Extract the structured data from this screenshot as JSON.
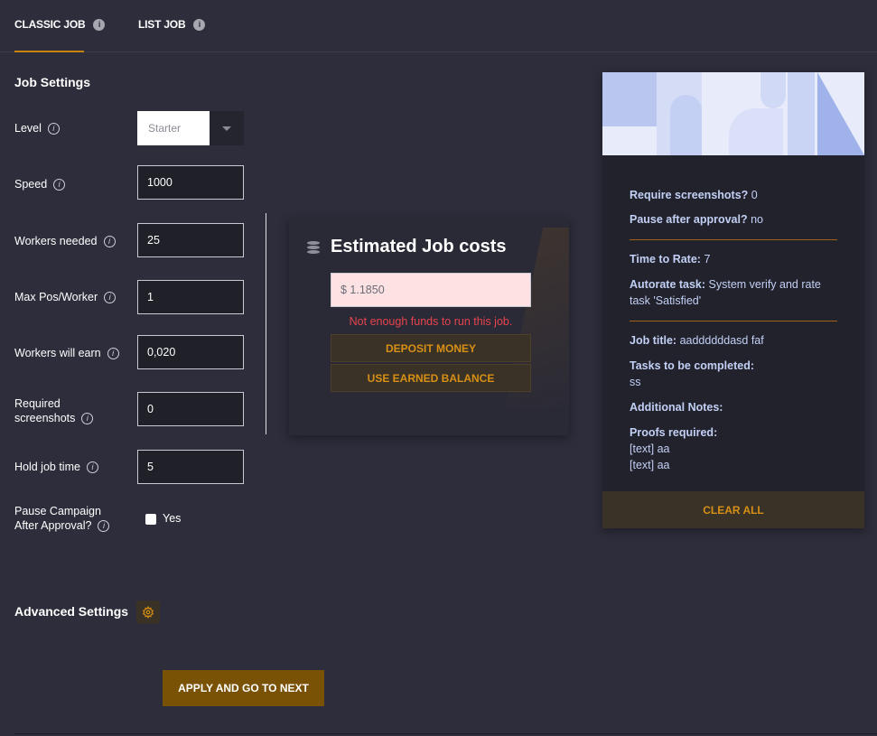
{
  "tabs": [
    {
      "label": "CLASSIC JOB"
    },
    {
      "label": "LIST JOB"
    }
  ],
  "job_settings": {
    "title": "Job Settings",
    "level_label": "Level",
    "level_value": "Starter",
    "speed_label": "Speed",
    "speed_value": "1000",
    "workers_needed_label": "Workers needed",
    "workers_needed_value": "25",
    "max_pos_label": "Max Pos/Worker",
    "max_pos_value": "1",
    "workers_earn_label": "Workers will earn",
    "workers_earn_value": "0,020",
    "required_screenshots_label_1": "Required",
    "required_screenshots_label_2": "screenshots",
    "required_screenshots_value": "0",
    "hold_job_label": "Hold job time",
    "hold_job_value": "5",
    "pause_label_1": "Pause Campaign",
    "pause_label_2": "After Approval?",
    "pause_option": "Yes"
  },
  "costs": {
    "title": "Estimated Job costs",
    "amount": "$ 1.1850",
    "error": "Not enough funds to run this job.",
    "deposit_label": "DEPOSIT MONEY",
    "earned_label": "USE EARNED BALANCE"
  },
  "summary": {
    "require_screenshots_k": "Require screenshots?",
    "require_screenshots_v": "0",
    "pause_k": "Pause after approval?",
    "pause_v": "no",
    "time_to_rate_k": "Time to Rate:",
    "time_to_rate_v": "7",
    "autorate_k": "Autorate task:",
    "autorate_v1": "System verify and rate",
    "autorate_v2": "task 'Satisfied'",
    "job_title_k": "Job title:",
    "job_title_v": "aaddddddasd faf",
    "tasks_k": "Tasks to be completed:",
    "tasks_v": "ss",
    "notes_k": "Additional Notes:",
    "proofs_k": "Proofs required:",
    "proof_1": "[text] aa",
    "proof_2": "[text] aa",
    "clear_label": "CLEAR ALL"
  },
  "advanced": {
    "title": "Advanced Settings"
  },
  "apply_label": "APPLY AND GO TO NEXT",
  "colors": {
    "background": "#2d2d3b",
    "accent": "#d79015",
    "error": "#e8434d"
  }
}
